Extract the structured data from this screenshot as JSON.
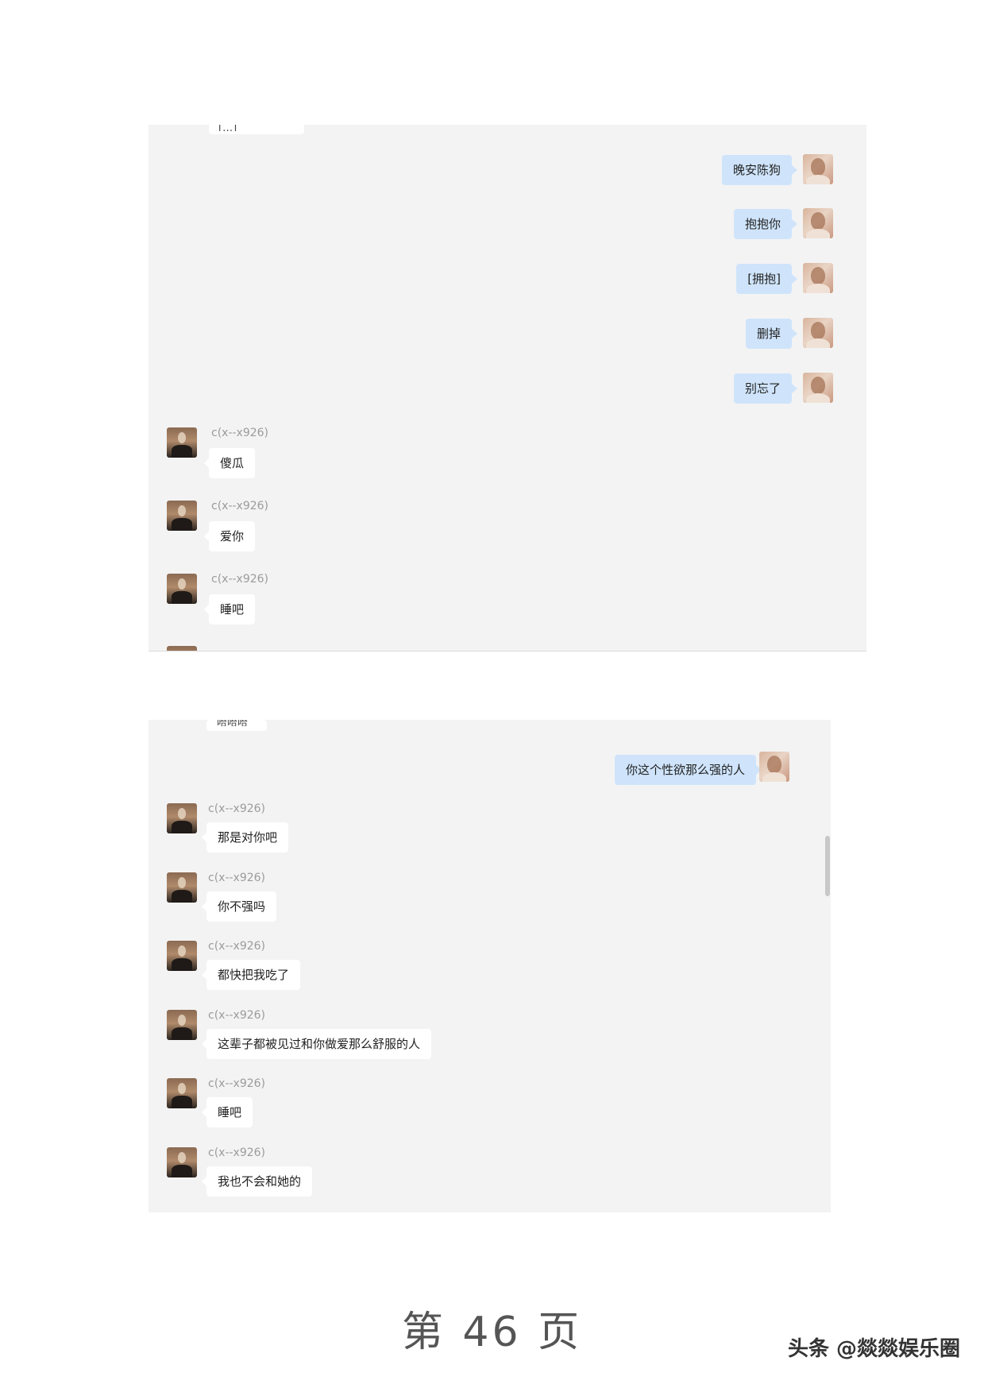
{
  "panel1": {
    "cut_top_text": "[…]",
    "outgoing": [
      "晚安陈狗",
      "抱抱你",
      "[拥抱]",
      "删掉",
      "别忘了"
    ],
    "incoming": [
      {
        "sender": "c(x--x926)",
        "text": "傻瓜"
      },
      {
        "sender": "c(x--x926)",
        "text": "爱你"
      },
      {
        "sender": "c(x--x926)",
        "text": "睡吧"
      }
    ]
  },
  "panel2": {
    "cut_top_text": "哈哈哈",
    "outgoing": [
      "你这个性欲那么强的人"
    ],
    "incoming": [
      {
        "sender": "c(x--x926)",
        "text": "那是对你吧"
      },
      {
        "sender": "c(x--x926)",
        "text": "你不强吗"
      },
      {
        "sender": "c(x--x926)",
        "text": "都快把我吃了"
      },
      {
        "sender": "c(x--x926)",
        "text": "这辈子都被见过和你做爱那么舒服的人"
      },
      {
        "sender": "c(x--x926)",
        "text": "睡吧"
      },
      {
        "sender": "c(x--x926)",
        "text": "我也不会和她的"
      }
    ]
  },
  "footer": {
    "page_number": "第 46 页",
    "watermark": "头条 @燚燚娱乐圈"
  }
}
